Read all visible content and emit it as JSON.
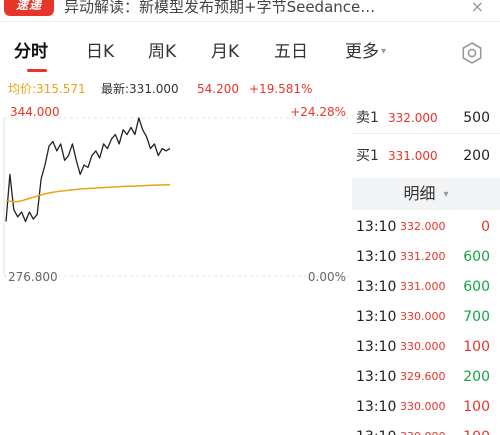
{
  "banner": {
    "badge": "速递",
    "text": "异动解读：新模型发布预期+字节Seedance…",
    "close": "×"
  },
  "tabs": [
    {
      "label": "分时",
      "active": true
    },
    {
      "label": "日K"
    },
    {
      "label": "周K"
    },
    {
      "label": "月K"
    },
    {
      "label": "五日"
    },
    {
      "label": "更多"
    }
  ],
  "more_caret": "▾",
  "stats": {
    "avg_label": "均价:",
    "avg_value": "315.571",
    "latest_label": "最新:",
    "latest_value": "331.000",
    "change": "54.200",
    "change_pct": "+19.581%"
  },
  "chart": {
    "high_price": "344.000",
    "high_pct": "+24.28%",
    "base_price": "276.800",
    "base_pct": "0.00%",
    "price_color": "#222222",
    "avg_color": "#e8a317"
  },
  "chart_data": {
    "type": "line",
    "ylim": [
      276.8,
      344.0
    ],
    "series": [
      {
        "values": [
          300,
          320,
          305,
          302,
          304,
          300,
          304,
          301,
          303,
          318,
          324,
          332,
          334,
          330,
          333,
          326,
          328,
          333,
          326,
          320,
          324,
          323,
          328,
          330,
          327,
          333,
          331,
          335,
          337,
          333,
          339,
          337,
          340,
          337,
          344,
          339,
          336,
          331,
          333,
          328,
          331,
          330,
          331
        ]
      },
      {
        "values": [
          309.0,
          308.6,
          308.4,
          308.5,
          308.8,
          309.3,
          309.8,
          310.3,
          310.8,
          311.3,
          311.7,
          312.1,
          312.4,
          312.7,
          312.9,
          313.1,
          313.3,
          313.5,
          313.6,
          313.8,
          313.9,
          314.0,
          314.1,
          314.2,
          314.3,
          314.4,
          314.5,
          314.6,
          314.7,
          314.8,
          314.9,
          314.95,
          315.0,
          315.05,
          315.1,
          315.2,
          315.3,
          315.4,
          315.45,
          315.5,
          315.52,
          315.55,
          315.571
        ]
      }
    ]
  },
  "order_book": {
    "sell": {
      "label": "卖1",
      "price": "332.000",
      "volume": "500"
    },
    "buy": {
      "label": "买1",
      "price": "331.000",
      "volume": "200"
    }
  },
  "detail": {
    "label": "明细",
    "caret": "▾"
  },
  "trades": [
    {
      "time": "13:10",
      "price": "332.000",
      "volume": "0",
      "color": "red"
    },
    {
      "time": "13:10",
      "price": "331.200",
      "volume": "600",
      "color": "green"
    },
    {
      "time": "13:10",
      "price": "331.000",
      "volume": "600",
      "color": "green"
    },
    {
      "time": "13:10",
      "price": "330.000",
      "volume": "700",
      "color": "green"
    },
    {
      "time": "13:10",
      "price": "330.000",
      "volume": "100",
      "color": "red"
    },
    {
      "time": "13:10",
      "price": "329.600",
      "volume": "200",
      "color": "green"
    },
    {
      "time": "13:10",
      "price": "330.000",
      "volume": "100",
      "color": "red"
    },
    {
      "time": "13:10",
      "price": "330.000",
      "volume": "100",
      "color": "red"
    }
  ]
}
